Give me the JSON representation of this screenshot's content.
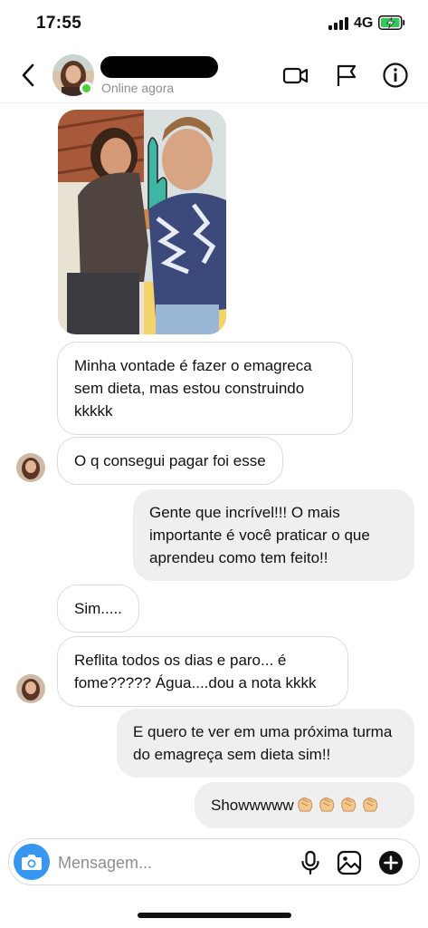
{
  "status_bar": {
    "time": "17:55",
    "network": "4G",
    "battery_charging": true
  },
  "header": {
    "status": "Online agora",
    "name_redacted": true
  },
  "messages": [
    {
      "id": "m1",
      "from": "them",
      "text": "Minha vontade é fazer o emagreca sem dieta, mas estou construindo kkkkk"
    },
    {
      "id": "m2",
      "from": "them",
      "text": "O q consegui pagar foi esse"
    },
    {
      "id": "m3",
      "from": "me",
      "text": "Gente que incrível!!! O mais importante é você praticar o que aprendeu como tem feito!!"
    },
    {
      "id": "m4",
      "from": "them",
      "text": "Sim....."
    },
    {
      "id": "m5",
      "from": "them",
      "text": "Reflita todos os dias e paro... é fome????? Água....dou a nota kkkk"
    },
    {
      "id": "m6",
      "from": "me",
      "text": "E quero te ver em uma próxima turma do emagreça sem dieta sim!!"
    },
    {
      "id": "m7",
      "from": "me",
      "text": "Showwwww",
      "emoji": "clapping-hands x4"
    }
  ],
  "composer": {
    "placeholder": "Mensagem..."
  },
  "colors": {
    "accent": "#3797f0",
    "online": "#4cd137",
    "outgoing_bubble": "#efefef",
    "border": "#dbdbdb"
  }
}
